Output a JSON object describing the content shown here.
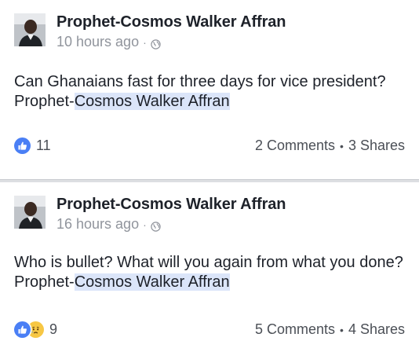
{
  "posts": [
    {
      "author": "Prophet-Cosmos Walker Affran",
      "time": "10 hours ago",
      "separator": "·",
      "text_plain": "Can Ghanaians fast for three days for vice president? Prophet-",
      "text_highlight": "Cosmos Walker Affran",
      "reactions": [
        "like-icon"
      ],
      "reaction_count": "11",
      "comments": "2 Comments",
      "shares": "3 Shares"
    },
    {
      "author": "Prophet-Cosmos Walker Affran",
      "time": "16 hours ago",
      "separator": "·",
      "text_plain": "Who is bullet? What will you again from what you done? Prophet-",
      "text_highlight": "Cosmos Walker Affran",
      "reactions": [
        "like-icon",
        "sad-icon"
      ],
      "reaction_count": "9",
      "comments": "5 Comments",
      "shares": "4 Shares"
    }
  ],
  "dot": "•",
  "colors": {
    "like_blue": "#4a7ff5",
    "highlight": "#dbe5f9",
    "meta_gray": "#90949c",
    "text": "#1d2129",
    "sad_yellow": "#f7c744"
  }
}
